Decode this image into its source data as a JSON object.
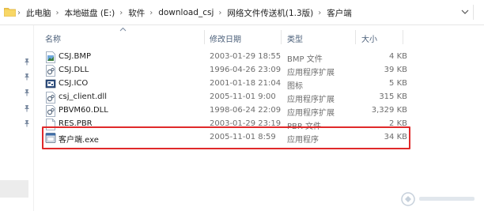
{
  "breadcrumb": {
    "items": [
      "此电脑",
      "本地磁盘 (E:)",
      "软件",
      "download_csj",
      "网络文件传送机(1.3版)",
      "客户端"
    ]
  },
  "columns": {
    "name": "名称",
    "modified": "修改日期",
    "type": "类型",
    "size": "大小"
  },
  "files": [
    {
      "name": "CSJ.BMP",
      "modified": "2003-01-29 18:55",
      "type": "BMP 文件",
      "size": "4 KB",
      "icon": "image-file-icon"
    },
    {
      "name": "CSJ.DLL",
      "modified": "1996-04-26 23:09",
      "type": "应用程序扩展",
      "size": "39 KB",
      "icon": "dll-file-icon"
    },
    {
      "name": "CSJ.ICO",
      "modified": "2001-01-18 21:04",
      "type": "图标",
      "size": "5 KB",
      "icon": "ico-file-icon"
    },
    {
      "name": "csj_client.dll",
      "modified": "2005-11-01 9:00",
      "type": "应用程序扩展",
      "size": "315 KB",
      "icon": "dll-file-icon"
    },
    {
      "name": "PBVM60.DLL",
      "modified": "1998-06-24 22:09",
      "type": "应用程序扩展",
      "size": "3,329 KB",
      "icon": "dll-file-icon"
    },
    {
      "name": "RES.PBR",
      "modified": "2003-01-29 23:19",
      "type": "PBR 文件",
      "size": "2 KB",
      "icon": "generic-file-icon"
    },
    {
      "name": "客户端.exe",
      "modified": "2005-11-01 8:59",
      "type": "应用程序",
      "size": "34 KB",
      "icon": "exe-file-icon"
    }
  ],
  "highlighted_file_index": 6,
  "colors": {
    "highlight_border": "#e0292a",
    "header_text": "#4c607a",
    "meta_text": "#6d6d6d",
    "folder_yellow": "#f2c94c"
  }
}
